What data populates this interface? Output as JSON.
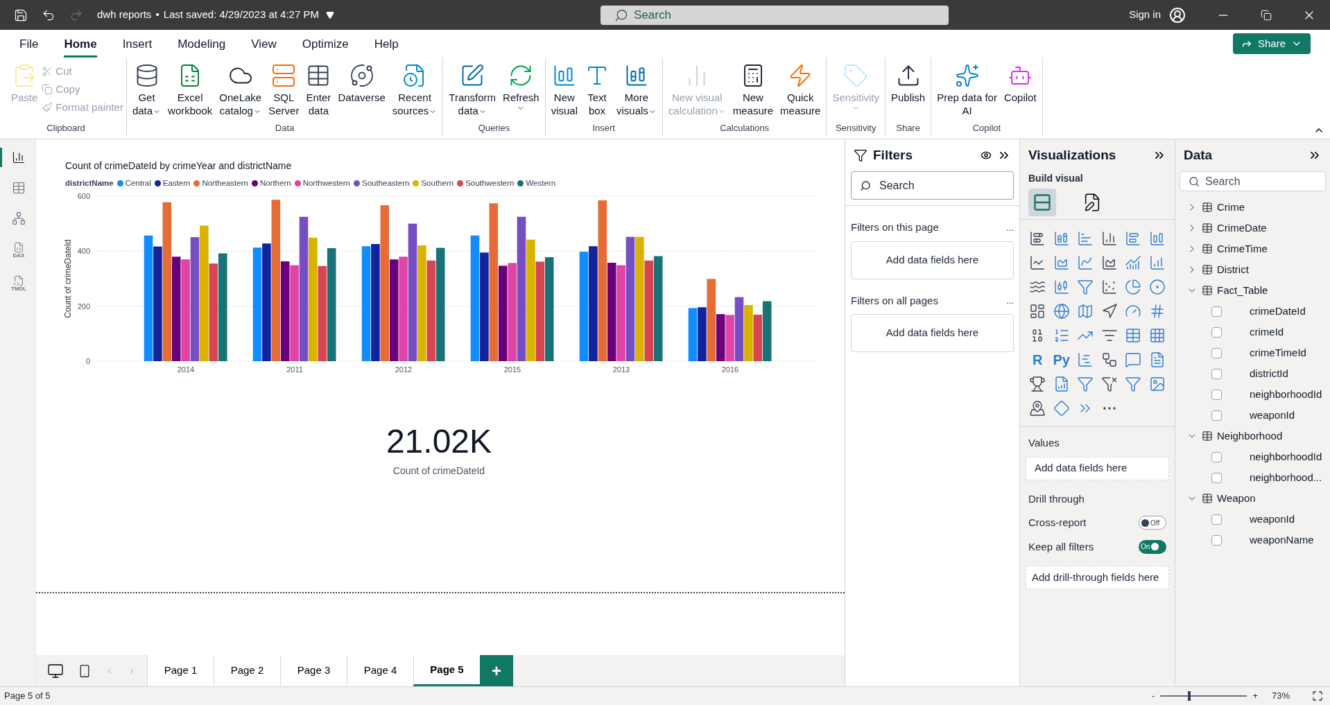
{
  "window": {
    "file_name": "dwh reports",
    "separator": "•",
    "saved": "Last saved: 4/29/2023 at 4:27 PM",
    "search_placeholder": "Search",
    "sign_in": "Sign in"
  },
  "menu": [
    {
      "label": "File",
      "selected": false
    },
    {
      "label": "Home",
      "selected": true
    },
    {
      "label": "Insert",
      "selected": false
    },
    {
      "label": "Modeling",
      "selected": false
    },
    {
      "label": "View",
      "selected": false
    },
    {
      "label": "Optimize",
      "selected": false
    },
    {
      "label": "Help",
      "selected": false
    }
  ],
  "share": "Share",
  "ribbon": [
    {
      "group": "Clipboard",
      "buttons": [
        {
          "lines": [
            "Paste"
          ],
          "kind": "large",
          "disabled": true,
          "dropdown": false
        },
        {
          "lines": [
            "Cut"
          ],
          "kind": "small",
          "disabled": true
        },
        {
          "lines": [
            "Copy"
          ],
          "kind": "small",
          "disabled": true
        },
        {
          "lines": [
            "Format painter"
          ],
          "kind": "small",
          "disabled": true
        }
      ]
    },
    {
      "group": "Data",
      "buttons": [
        {
          "lines": [
            "Get",
            "data"
          ],
          "kind": "large",
          "disabled": false,
          "dropdown": true
        },
        {
          "lines": [
            "Excel",
            "workbook"
          ],
          "kind": "large",
          "disabled": false,
          "dropdown": false
        },
        {
          "lines": [
            "OneLake",
            "catalog"
          ],
          "kind": "large",
          "disabled": false,
          "dropdown": true
        },
        {
          "lines": [
            "SQL",
            "Server"
          ],
          "kind": "large",
          "disabled": false,
          "dropdown": false
        },
        {
          "lines": [
            "Enter",
            "data"
          ],
          "kind": "large",
          "disabled": false,
          "dropdown": false
        },
        {
          "lines": [
            "Dataverse"
          ],
          "kind": "large",
          "disabled": false,
          "dropdown": false
        },
        {
          "lines": [
            "Recent",
            "sources"
          ],
          "kind": "large",
          "disabled": false,
          "dropdown": true
        }
      ]
    },
    {
      "group": "Queries",
      "buttons": [
        {
          "lines": [
            "Transform",
            "data"
          ],
          "kind": "large",
          "disabled": false,
          "dropdown": true
        },
        {
          "lines": [
            "Refresh"
          ],
          "kind": "large",
          "disabled": false,
          "dropdown": true
        }
      ]
    },
    {
      "group": "Insert",
      "buttons": [
        {
          "lines": [
            "New",
            "visual"
          ],
          "kind": "large",
          "disabled": false,
          "dropdown": false
        },
        {
          "lines": [
            "Text",
            "box"
          ],
          "kind": "large",
          "disabled": false,
          "dropdown": false
        },
        {
          "lines": [
            "More",
            "visuals"
          ],
          "kind": "large",
          "disabled": false,
          "dropdown": true
        }
      ]
    },
    {
      "group": "Calculations",
      "buttons": [
        {
          "lines": [
            "New visual",
            "calculation"
          ],
          "kind": "large",
          "disabled": true,
          "dropdown": true
        },
        {
          "lines": [
            "New",
            "measure"
          ],
          "kind": "large",
          "disabled": false,
          "dropdown": false
        },
        {
          "lines": [
            "Quick",
            "measure"
          ],
          "kind": "large",
          "disabled": false,
          "dropdown": false
        }
      ]
    },
    {
      "group": "Sensitivity",
      "buttons": [
        {
          "lines": [
            "Sensitivity"
          ],
          "kind": "large",
          "disabled": true,
          "dropdown": true
        }
      ]
    },
    {
      "group": "Share",
      "buttons": [
        {
          "lines": [
            "Publish"
          ],
          "kind": "large",
          "disabled": false,
          "dropdown": false
        }
      ]
    },
    {
      "group": "Copilot",
      "buttons": [
        {
          "lines": [
            "Prep data for",
            "AI"
          ],
          "kind": "large",
          "disabled": false,
          "dropdown": false
        },
        {
          "lines": [
            "Copilot"
          ],
          "kind": "large",
          "disabled": false,
          "dropdown": false
        }
      ]
    }
  ],
  "rail": [
    {
      "selected": true
    },
    {
      "selected": false
    },
    {
      "selected": false
    },
    {
      "selected": false,
      "label": "DAX"
    },
    {
      "selected": false,
      "label": "TMDL"
    }
  ],
  "chart": {
    "legend_title": "districtName",
    "chart_data": {
      "type": "bar",
      "title": "Count of crimeDateId by crimeYear and districtName",
      "ylabel": "Count of crimeDateId",
      "categories": [
        "2014",
        "2011",
        "2012",
        "2015",
        "2013",
        "2016"
      ],
      "ylim": [
        0,
        600
      ],
      "yticks": [
        0,
        200,
        400,
        600
      ],
      "series": [
        {
          "name": "Central",
          "color": "#118dff",
          "values": [
            457,
            413,
            418,
            457,
            398,
            193
          ]
        },
        {
          "name": "Eastern",
          "color": "#12239e",
          "values": [
            417,
            428,
            426,
            395,
            418,
            196
          ]
        },
        {
          "name": "Northeastern",
          "color": "#e66c37",
          "values": [
            578,
            587,
            567,
            574,
            585,
            299
          ]
        },
        {
          "name": "Northern",
          "color": "#6b007b",
          "values": [
            380,
            363,
            370,
            347,
            358,
            171
          ]
        },
        {
          "name": "Northwestern",
          "color": "#e044a7",
          "values": [
            370,
            349,
            380,
            357,
            349,
            168
          ]
        },
        {
          "name": "Southeastern",
          "color": "#744ec2",
          "values": [
            451,
            525,
            500,
            525,
            452,
            233
          ]
        },
        {
          "name": "Southern",
          "color": "#d9b300",
          "values": [
            493,
            449,
            421,
            442,
            452,
            204
          ]
        },
        {
          "name": "Southwestern",
          "color": "#d64550",
          "values": [
            355,
            346,
            366,
            362,
            366,
            169
          ]
        },
        {
          "name": "Western",
          "color": "#197278",
          "values": [
            392,
            411,
            412,
            378,
            382,
            218
          ]
        }
      ]
    }
  },
  "card": {
    "value": "21.02K",
    "label": "Count of crimeDateId"
  },
  "pages": [
    {
      "label": "Page 1",
      "selected": false
    },
    {
      "label": "Page 2",
      "selected": false
    },
    {
      "label": "Page 3",
      "selected": false
    },
    {
      "label": "Page 4",
      "selected": false
    },
    {
      "label": "Page 5",
      "selected": true
    }
  ],
  "add_page": "+",
  "filters": {
    "title": "Filters",
    "search_placeholder": "Search",
    "sections": [
      {
        "title": "Filters on this page",
        "more": "...",
        "drop": "Add data fields here"
      },
      {
        "title": "Filters on all pages",
        "more": "...",
        "drop": "Add data fields here"
      }
    ]
  },
  "visualizations": {
    "title": "Visualizations",
    "subtitle": "Build visual",
    "build_tabs": [
      {
        "selected": true
      },
      {
        "selected": false
      }
    ],
    "script_visuals": [
      "R",
      "Py"
    ],
    "values_title": "Values",
    "values_drop": "Add data fields here",
    "drill_title": "Drill through",
    "toggles": [
      {
        "label": "Cross-report",
        "on": false,
        "state": "Off"
      },
      {
        "label": "Keep all filters",
        "on": true,
        "state": "On"
      }
    ],
    "drill_drop": "Add drill-through fields here"
  },
  "data": {
    "title": "Data",
    "search_placeholder": "Search",
    "tables": [
      {
        "name": "Crime",
        "expanded": false
      },
      {
        "name": "CrimeDate",
        "expanded": false
      },
      {
        "name": "CrimeTime",
        "expanded": false
      },
      {
        "name": "District",
        "expanded": false
      },
      {
        "name": "Fact_Table",
        "expanded": true,
        "children": [
          {
            "name": "crimeDateId",
            "checked": false
          },
          {
            "name": "crimeId",
            "checked": false
          },
          {
            "name": "crimeTimeId",
            "checked": false
          },
          {
            "name": "districtId",
            "checked": false
          },
          {
            "name": "neighborhoodId",
            "checked": false
          },
          {
            "name": "weaponId",
            "checked": false
          }
        ]
      },
      {
        "name": "Neighborhood",
        "expanded": true,
        "children": [
          {
            "name": "neighborhoodId",
            "checked": false
          },
          {
            "name": "neighborhood...",
            "checked": false
          }
        ]
      },
      {
        "name": "Weapon",
        "expanded": true,
        "children": [
          {
            "name": "weaponId",
            "checked": false
          },
          {
            "name": "weaponName",
            "checked": false
          }
        ]
      }
    ]
  },
  "status": {
    "page": "Page 5 of 5",
    "zoom_out": "-",
    "zoom_in": "+",
    "zoom_slider": {
      "level": 0.32
    },
    "zoom": "73%"
  }
}
